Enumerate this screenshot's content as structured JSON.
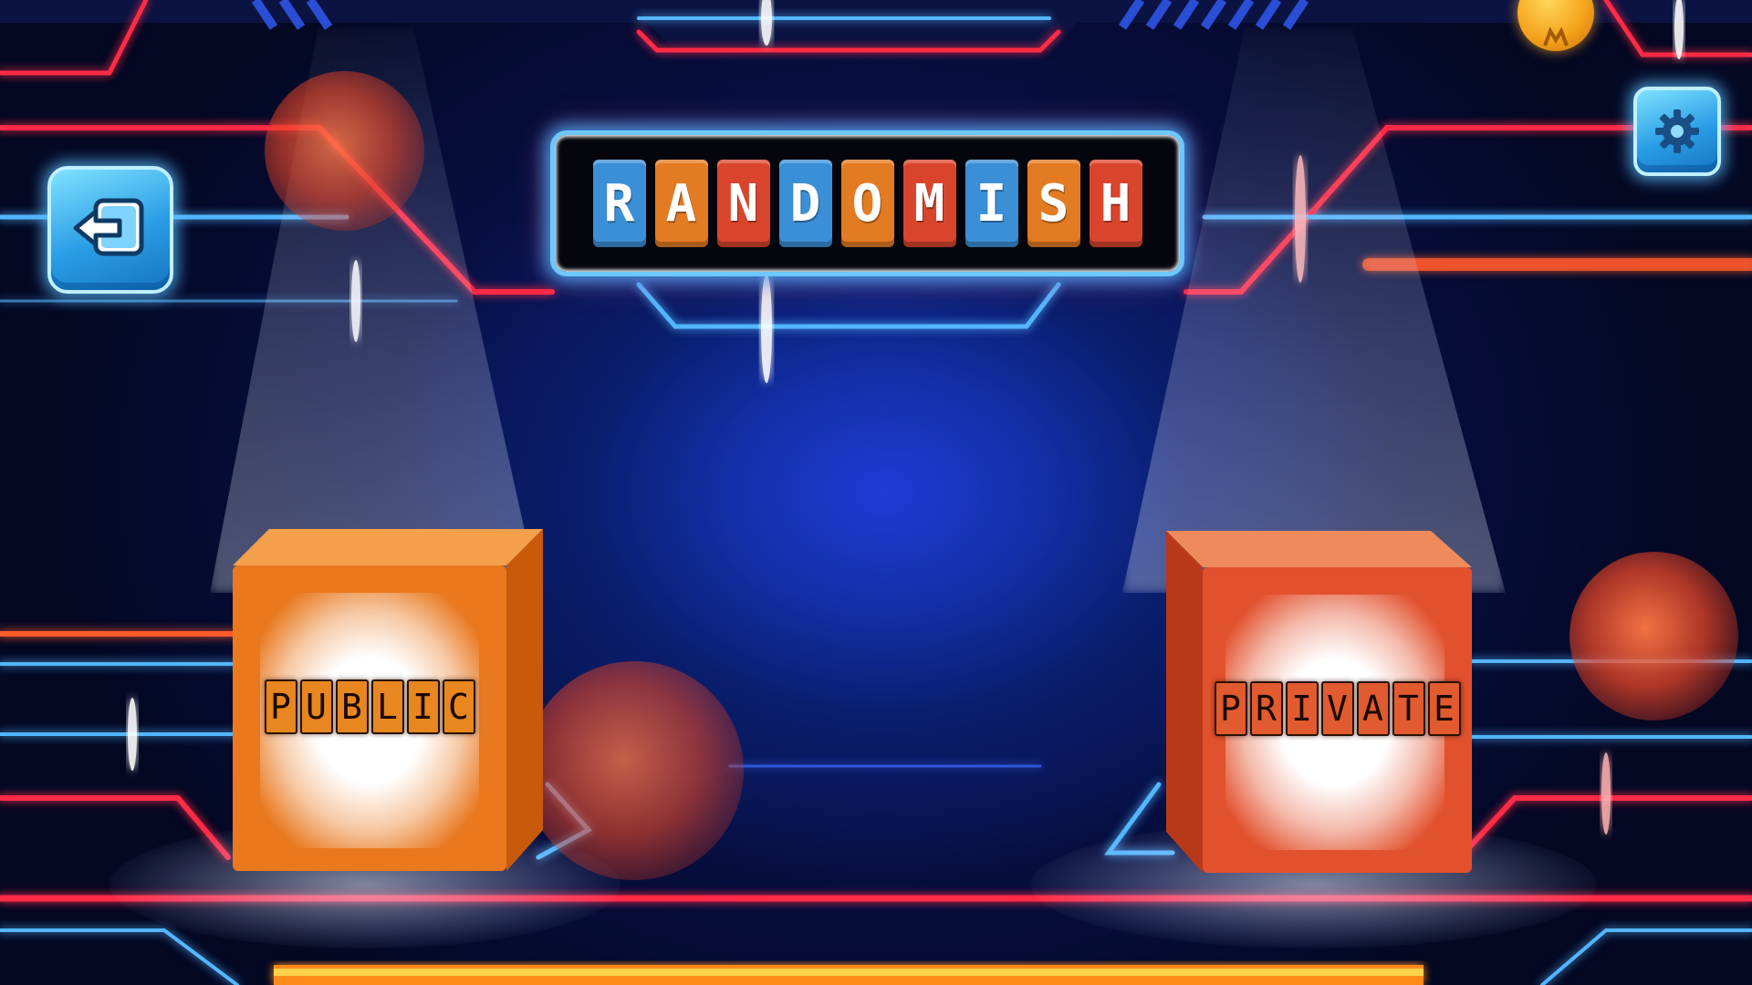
{
  "game": {
    "title_letters": [
      {
        "char": "R",
        "color": "#3b8fd6"
      },
      {
        "char": "A",
        "color": "#e37b22"
      },
      {
        "char": "N",
        "color": "#d9452c"
      },
      {
        "char": "D",
        "color": "#3b8fd6"
      },
      {
        "char": "O",
        "color": "#e37b22"
      },
      {
        "char": "M",
        "color": "#d9452c"
      },
      {
        "char": "I",
        "color": "#3b8fd6"
      },
      {
        "char": "S",
        "color": "#e37b22"
      },
      {
        "char": "H",
        "color": "#d9452c"
      }
    ]
  },
  "buttons": {
    "exit_icon": "exit-arrow-icon",
    "settings_icon": "gear-icon",
    "coin_icon": "gold-coin-icon"
  },
  "modes": [
    {
      "id": "public",
      "label": "PUBLIC",
      "letters": [
        "P",
        "U",
        "B",
        "L",
        "I",
        "C"
      ],
      "cube_color": "#e9781e",
      "tile_color": "#e8861f"
    },
    {
      "id": "private",
      "label": "PRIVATE",
      "letters": [
        "P",
        "R",
        "I",
        "V",
        "A",
        "T",
        "E"
      ],
      "cube_color": "#e2512d",
      "tile_color": "#e25a2f"
    }
  ],
  "colors": {
    "neon_red": "#ff2a45",
    "neon_blue": "#52b6ff",
    "background": "#0a1d6b"
  }
}
